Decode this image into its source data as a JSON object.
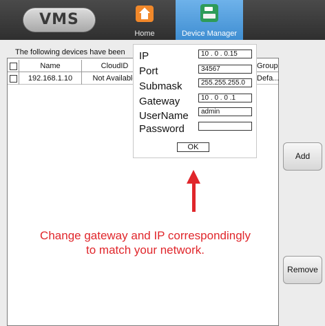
{
  "header": {
    "logo": "VMS",
    "nav": [
      {
        "label": "Home",
        "icon": "home-icon"
      },
      {
        "label": "Device Manager",
        "icon": "device-icon",
        "active": true
      }
    ]
  },
  "devices": {
    "caption": "The following devices have been",
    "columns": [
      "Name",
      "CloudID",
      "Group"
    ],
    "rows": [
      {
        "name": "192.168.1.10",
        "cloud_id": "Not Available",
        "group": "Defa..."
      }
    ]
  },
  "buttons": {
    "add": "Add",
    "remove": "Remove"
  },
  "network_dialog": {
    "fields": [
      {
        "label": "IP",
        "value": "10 . 0 . 0.15"
      },
      {
        "label": "Port",
        "value": "34567"
      },
      {
        "label": "Submask",
        "value": "255.255.255.0"
      },
      {
        "label": "Gateway",
        "value": "10 . 0 . 0 .1"
      },
      {
        "label": "UserName",
        "value": "admin"
      },
      {
        "label": "Password",
        "value": ""
      }
    ],
    "ok": "OK"
  },
  "annotation": {
    "line1": "Change gateway and IP correspondingly",
    "line2": "to match your network.",
    "color": "#e0262b"
  },
  "colors": {
    "header_bg": "#3a3a3a",
    "active_tab": "#4f9ddf",
    "home_icon": "#f1882a",
    "device_icon": "#2e9b59"
  }
}
